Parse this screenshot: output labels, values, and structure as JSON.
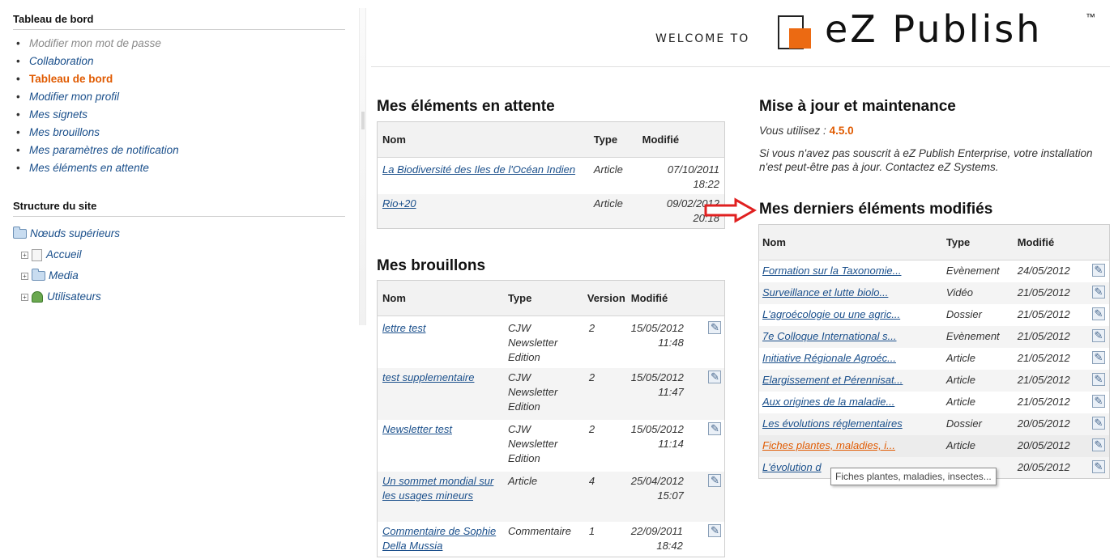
{
  "sidebar": {
    "dashboard_title": "Tableau de bord",
    "menu": [
      {
        "label": "Modifier mon mot de passe",
        "state": "disabled"
      },
      {
        "label": "Collaboration",
        "state": "normal"
      },
      {
        "label": "Tableau de bord",
        "state": "current"
      },
      {
        "label": "Modifier mon profil",
        "state": "normal"
      },
      {
        "label": "Mes signets",
        "state": "normal"
      },
      {
        "label": "Mes brouillons",
        "state": "normal"
      },
      {
        "label": "Mes paramètres de notification",
        "state": "normal"
      },
      {
        "label": "Mes éléments en attente",
        "state": "normal"
      }
    ],
    "structure_title": "Structure du site",
    "tree": {
      "root": "Nœuds supérieurs",
      "nodes": [
        "Accueil",
        "Media",
        "Utilisateurs"
      ]
    }
  },
  "header": {
    "welcome": "WELCOME TO",
    "logo": "eZ Publish",
    "tm": "™"
  },
  "pending": {
    "title": "Mes éléments en attente",
    "headers": [
      "Nom",
      "Type",
      "Modifié"
    ],
    "rows": [
      {
        "name": "La Biodiversité des Iles de l'Océan Indien",
        "type": "Article",
        "date": "07/10/2011",
        "time": "18:22"
      },
      {
        "name": "Rio+20",
        "type": "Article",
        "date": "09/02/2012",
        "time": "20:18"
      }
    ]
  },
  "drafts": {
    "title": "Mes brouillons",
    "headers": [
      "Nom",
      "Type",
      "Version",
      "Modifié"
    ],
    "rows": [
      {
        "name": "lettre test",
        "type": "CJW Newsletter Edition",
        "version": "2",
        "date": "15/05/2012",
        "time": "11:48"
      },
      {
        "name": "test supplementaire",
        "type": "CJW Newsletter Edition",
        "version": "2",
        "date": "15/05/2012",
        "time": "11:47"
      },
      {
        "name": "Newsletter test",
        "type": "CJW Newsletter Edition",
        "version": "2",
        "date": "15/05/2012",
        "time": "11:14"
      },
      {
        "name": "Un sommet mondial sur les usages mineurs",
        "type": "Article",
        "version": "4",
        "date": "25/04/2012",
        "time": "15:07"
      },
      {
        "name": "Commentaire de Sophie Della Mussia",
        "type": "Commentaire",
        "version": "1",
        "date": "22/09/2011",
        "time": "18:42"
      }
    ]
  },
  "maintenance": {
    "title": "Mise à jour et maintenance",
    "using_label": "Vous utilisez :",
    "version": "4.5.0",
    "notice": "Si vous n'avez pas souscrit à eZ Publish Enterprise, votre installation n'est peut-être pas à jour. Contactez eZ Systems."
  },
  "recent": {
    "title": "Mes derniers éléments modifiés",
    "headers": [
      "Nom",
      "Type",
      "Modifié"
    ],
    "rows": [
      {
        "name": "Formation sur la Taxonomie...",
        "type": "Evènement",
        "date": "24/05/2012"
      },
      {
        "name": "Surveillance et lutte biolo...",
        "type": "Vidéo",
        "date": "21/05/2012"
      },
      {
        "name": "L'agroécologie ou une agric...",
        "type": "Dossier",
        "date": "21/05/2012"
      },
      {
        "name": "7e Colloque International s...",
        "type": "Evènement",
        "date": "21/05/2012"
      },
      {
        "name": "Initiative Régionale Agroéc...",
        "type": "Article",
        "date": "21/05/2012"
      },
      {
        "name": "Elargissement et Pérennisat...",
        "type": "Article",
        "date": "21/05/2012"
      },
      {
        "name": "Aux origines de la maladie...",
        "type": "Article",
        "date": "21/05/2012"
      },
      {
        "name": "Les évolutions réglementaires",
        "type": "Dossier",
        "date": "20/05/2012"
      },
      {
        "name": "Fiches plantes, maladies, i...",
        "type": "Article",
        "date": "20/05/2012"
      },
      {
        "name": "L'évolution d",
        "type": "",
        "date": "20/05/2012"
      }
    ],
    "tooltip": "Fiches plantes, maladies, insectes..."
  },
  "colors": {
    "accent_orange": "#e05a00",
    "link_blue": "#1a4f8b",
    "annotation_red": "#e02020"
  }
}
